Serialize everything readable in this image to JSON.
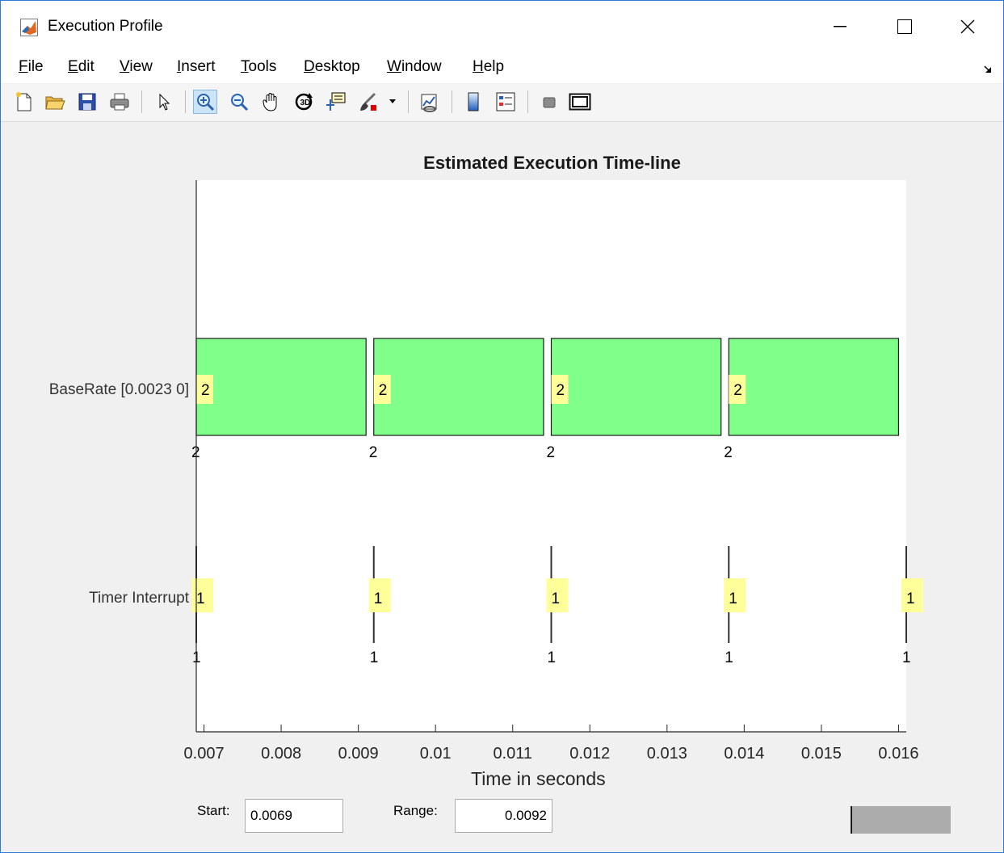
{
  "window": {
    "title": "Execution Profile",
    "icon": "matlab-logo-icon"
  },
  "menu": {
    "items": [
      {
        "label": "File",
        "mnemonic": "F",
        "rest": "ile"
      },
      {
        "label": "Edit",
        "mnemonic": "E",
        "rest": "dit"
      },
      {
        "label": "View",
        "mnemonic": "V",
        "rest": "iew"
      },
      {
        "label": "Insert",
        "mnemonic": "I",
        "rest": "nsert"
      },
      {
        "label": "Tools",
        "mnemonic": "T",
        "rest": "ools"
      },
      {
        "label": "Desktop",
        "mnemonic": "D",
        "rest": "esktop"
      },
      {
        "label": "Window",
        "mnemonic": "W",
        "rest": "indow"
      },
      {
        "label": "Help",
        "mnemonic": "H",
        "rest": "elp"
      }
    ]
  },
  "toolbar": {
    "buttons": [
      "new-figure-icon",
      "open-file-icon",
      "save-icon",
      "print-icon",
      "select-arrow-icon",
      "zoom-in-icon",
      "zoom-out-icon",
      "pan-hand-icon",
      "rotate-3d-icon",
      "data-cursor-icon",
      "brush-icon",
      "brush-dropdown-icon",
      "link-plot-icon",
      "colorbar-icon",
      "legend-icon",
      "hide-plot-tools-icon",
      "show-plot-tools-icon"
    ],
    "active": "zoom-in-icon"
  },
  "chart_data": {
    "type": "timeline",
    "title": "Estimated Execution Time-line",
    "xlabel": "Time in seconds",
    "xlim": [
      0.0069,
      0.0161
    ],
    "xticks": [
      "0.007",
      "0.008",
      "0.009",
      "0.01",
      "0.011",
      "0.012",
      "0.013",
      "0.014",
      "0.015",
      "0.016"
    ],
    "xtick_values": [
      0.007,
      0.008,
      0.009,
      0.01,
      0.011,
      0.012,
      0.013,
      0.014,
      0.015,
      0.016
    ],
    "rows": [
      {
        "label": "BaseRate [0.0023 0]",
        "task_id": "2",
        "color": "#80ff8a",
        "bars": [
          [
            0.0069,
            0.0091
          ],
          [
            0.0092,
            0.0114
          ],
          [
            0.0115,
            0.0137
          ],
          [
            0.0138,
            0.016
          ]
        ]
      },
      {
        "label": "Timer Interrupt",
        "task_id": "1",
        "color": "#ffff99",
        "events": [
          0.0069,
          0.0092,
          0.0115,
          0.0138,
          0.0161
        ]
      }
    ]
  },
  "controls": {
    "start_label": "Start:",
    "start_value": "0.0069",
    "range_label": "Range:",
    "range_value": "0.0092"
  }
}
